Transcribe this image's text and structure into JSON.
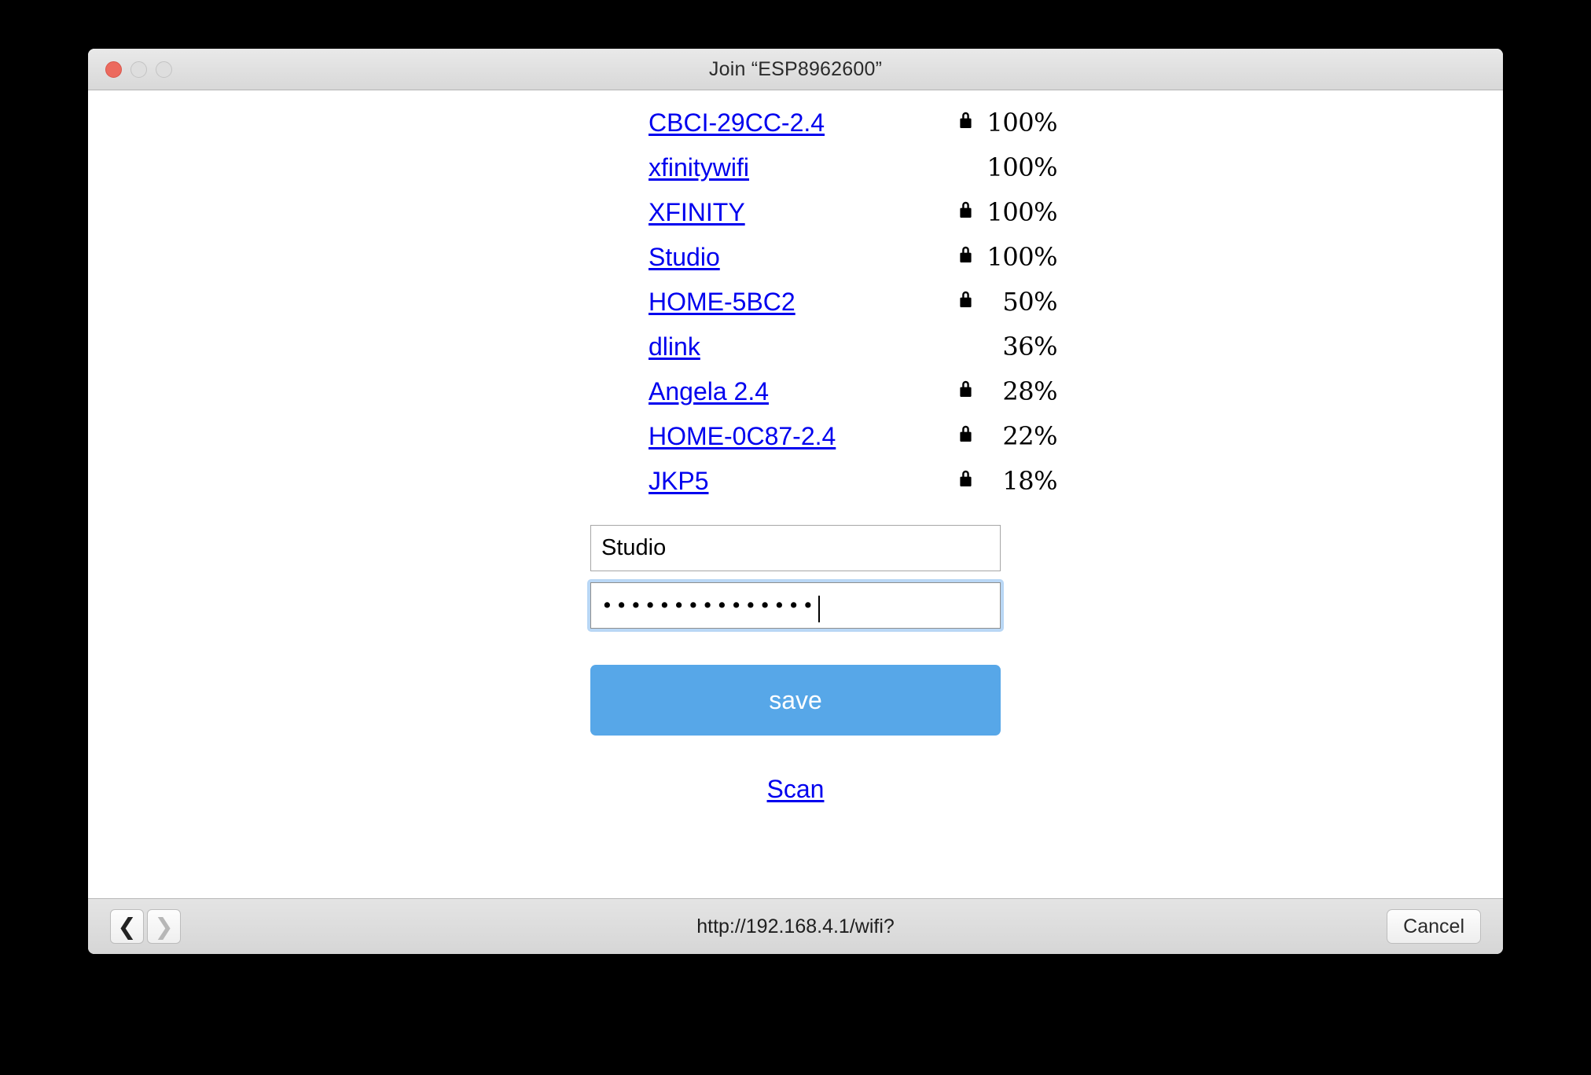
{
  "window": {
    "title": "Join “ESP8962600”",
    "traffic_lights": [
      {
        "name": "close",
        "color": "#ec6a5e"
      },
      {
        "name": "minimize",
        "color": "#dedede"
      },
      {
        "name": "maximize",
        "color": "#dedede"
      }
    ]
  },
  "networks": [
    {
      "ssid": "CBCI-29CC-2.4",
      "secured": true,
      "signal": "100%"
    },
    {
      "ssid": "xfinitywifi",
      "secured": false,
      "signal": "100%"
    },
    {
      "ssid": "XFINITY",
      "secured": true,
      "signal": "100%"
    },
    {
      "ssid": "Studio",
      "secured": true,
      "signal": "100%"
    },
    {
      "ssid": "HOME-5BC2",
      "secured": true,
      "signal": "50%"
    },
    {
      "ssid": "dlink",
      "secured": false,
      "signal": "36%"
    },
    {
      "ssid": "Angela 2.4",
      "secured": true,
      "signal": "28%"
    },
    {
      "ssid": "HOME-0C87-2.4",
      "secured": true,
      "signal": "22%"
    },
    {
      "ssid": "JKP5",
      "secured": true,
      "signal": "18%"
    }
  ],
  "form": {
    "ssid_value": "Studio",
    "ssid_placeholder": "",
    "password_value": "•••••••••••••••",
    "password_placeholder": "",
    "password_focused": true,
    "save_label": "save",
    "save_color": "#57a7e8",
    "scan_label": "Scan",
    "link_color": "#0000ee"
  },
  "bottombar": {
    "back_label": "❮",
    "forward_label": "❯",
    "back_enabled": true,
    "forward_enabled": false,
    "url": "http://192.168.4.1/wifi?",
    "cancel_label": "Cancel"
  }
}
